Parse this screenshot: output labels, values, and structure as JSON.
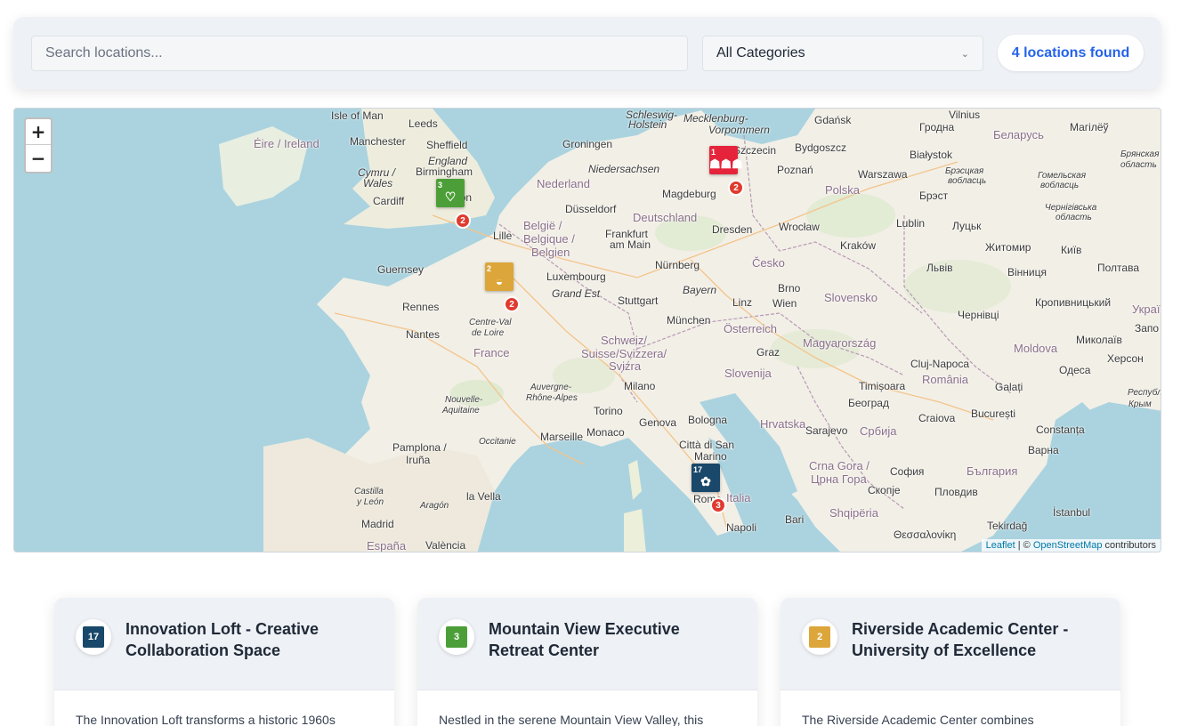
{
  "filters": {
    "search_placeholder": "Search locations...",
    "category_value": "All Categories",
    "count_text": "4 locations found"
  },
  "map": {
    "zoom_in": "+",
    "zoom_out": "−",
    "attribution": {
      "leaflet": "Leaflet",
      "sep": " | © ",
      "osm": "OpenStreetMap",
      "suffix": " contributors"
    },
    "labels": {
      "isle_of_man": "Isle of Man",
      "leeds": "Leeds",
      "manchester": "Manchester",
      "sheffield": "Sheffield",
      "eire": "Éire / Ireland",
      "england": "England",
      "birmingham": "Birmingham",
      "cymru": "Cymru /",
      "wales": "Wales",
      "cardiff": "Cardiff",
      "london": "London",
      "guernsey": "Guernsey",
      "lille": "Lille",
      "groningen": "Groningen",
      "nederland": "Nederland",
      "niedersachsen": "Niedersachsen",
      "mecklenburg": "Mecklenburg-",
      "vorpommern": "Vorpommern",
      "schleswig": "Schleswig-",
      "holstein": "Holstein",
      "dusseldorf": "Düsseldorf",
      "deutschland": "Deutschland",
      "magdeburg": "Magdeburg",
      "belgie": "België /",
      "belgique": "Belgique /",
      "belgien": "Belgien",
      "frankfurt": "Frankfurt",
      "am_main": "am Main",
      "dresden": "Dresden",
      "luxembourg": "Luxembourg",
      "nurnberg": "Nürnberg",
      "grand_est": "Grand Est",
      "stuttgart": "Stuttgart",
      "bayern": "Bayern",
      "munchen": "München",
      "cesko": "Česko",
      "gdansk": "Gdańsk",
      "szczecin": "Szczecin",
      "bydgoszcz": "Bydgoszcz",
      "poznan": "Poznań",
      "warszawa": "Warszawa",
      "polska": "Polska",
      "wroclaw": "Wrocław",
      "krakow": "Kraków",
      "lublin": "Lublin",
      "bialystok": "Białystok",
      "grodna": "Гродна",
      "belarus": "Беларусь",
      "vilnius": "Vilnius",
      "mahileu": "Магілёў",
      "brest": "Брэст",
      "lutsk": "Луцьк",
      "zhytomyr": "Житомир",
      "lviv": "Львів",
      "vinnytsia": "Вінниця",
      "kyiv": "Київ",
      "poltava": "Полтава",
      "ukraina": "Україна",
      "kropyvnytskyi": "Кропивницький",
      "mykolaiv": "Миколаїв",
      "kherson": "Херсон",
      "odesa": "Одеса",
      "moldova": "Moldova",
      "chernivtsi": "Чернівці",
      "chernihiv_obl": "Чернігівська",
      "oblast": "область",
      "bryansk_obl": "Брянская",
      "bryansk_obl2": "область",
      "brest_obl": "Брэсцкая",
      "brest_obl2": "вобласць",
      "gomel_obl": "Гомельская",
      "gomel_obl2": "вобласць",
      "rennes": "Rennes",
      "nantes": "Nantes",
      "centre": "Centre-Val",
      "de_loire": "de Loire",
      "france": "France",
      "nouvelle": "Nouvelle-",
      "aquitaine": "Aquitaine",
      "auvergne": "Auvergne-",
      "rhone": "Rhône-Alpes",
      "occitanie": "Occitanie",
      "linz": "Linz",
      "wien": "Wien",
      "brno": "Brno",
      "slovensko": "Slovensko",
      "osterreich": "Österreich",
      "magyarorszag": "Magyarország",
      "graz": "Graz",
      "slovenija": "Slovenija",
      "schweiz": "Schweiz/",
      "suisse": "Suisse/Svizzera/",
      "svizra": "Svizra",
      "milano": "Milano",
      "torino": "Torino",
      "genova": "Genova",
      "bologna": "Bologna",
      "monaco": "Monaco",
      "marseille": "Marseille",
      "citta": "Città di San",
      "marino": "Marino",
      "hrvatska": "Hrvatska",
      "sarajevo": "Sarajevo",
      "srbija": "Србија",
      "beograd": "Београд",
      "timisoara": "Timișoara",
      "cluj": "Cluj-Napoca",
      "romania": "România",
      "galati": "Galați",
      "craiova": "Craiova",
      "bucuresti": "București",
      "constanta": "Constanța",
      "varna": "Варна",
      "crna_gora": "Crna Gora /",
      "crna_gora2": "Црна Гора",
      "sofia": "София",
      "bulgaria": "България",
      "skopje": "Скопје",
      "plovdiv": "Пловдив",
      "shqiperia": "Shqipëria",
      "tekirdag": "Tekirdağ",
      "istanbul": "İstanbul",
      "thessaloniki": "Θεσσαλονίκη",
      "italia": "Italia",
      "roma": "Roma",
      "napoli": "Napoli",
      "bari": "Bari",
      "pamplona": "Pamplona /",
      "iruna": "Iruña",
      "castilla": "Castilla",
      "y_leon": "y León",
      "aragon": "Aragón",
      "la_vella": "la Vella",
      "madrid": "Madrid",
      "espana": "España",
      "valencia": "València",
      "respub": "Республ",
      "krym": "Крым",
      "zapo": "Запо"
    },
    "markers": [
      {
        "goal": "1",
        "color": "#e5243b",
        "count": "2"
      },
      {
        "goal": "3",
        "color": "#4c9f38",
        "count": "2"
      },
      {
        "goal": "2",
        "color": "#dda63a",
        "count": "2"
      },
      {
        "goal": "17",
        "color": "#19486a",
        "count": "3"
      }
    ]
  },
  "cards": [
    {
      "title": "Innovation Loft - Creative Collaboration Space",
      "goal": "17",
      "color": "#19486a",
      "text": "The Innovation Loft transforms a historic 1960s"
    },
    {
      "title": "Mountain View Executive Retreat Center",
      "goal": "3",
      "color": "#4c9f38",
      "text": "Nestled in the serene Mountain View Valley, this"
    },
    {
      "title": "Riverside Academic Center - University of Excellence",
      "goal": "2",
      "color": "#dda63a",
      "text": "The Riverside Academic Center combines"
    }
  ]
}
